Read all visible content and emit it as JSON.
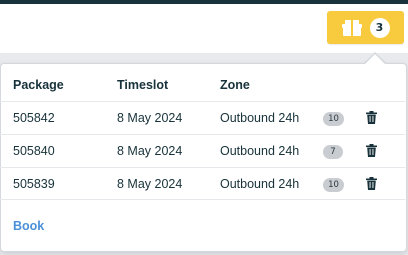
{
  "header": {
    "package_count": "3",
    "button_color": "#f7cb3d"
  },
  "popover": {
    "columns": {
      "package": "Package",
      "timeslot": "Timeslot",
      "zone": "Zone"
    },
    "rows": [
      {
        "package": "505842",
        "timeslot": "8 May 2024",
        "zone": "Outbound 24h",
        "badge": "10"
      },
      {
        "package": "505840",
        "timeslot": "8 May 2024",
        "zone": "Outbound 24h",
        "badge": "7"
      },
      {
        "package": "505839",
        "timeslot": "8 May 2024",
        "zone": "Outbound 24h",
        "badge": "10"
      }
    ],
    "book_label": "Book",
    "icons": {
      "button_icon": "boxes-icon",
      "row_action_icon": "trash-icon"
    }
  }
}
